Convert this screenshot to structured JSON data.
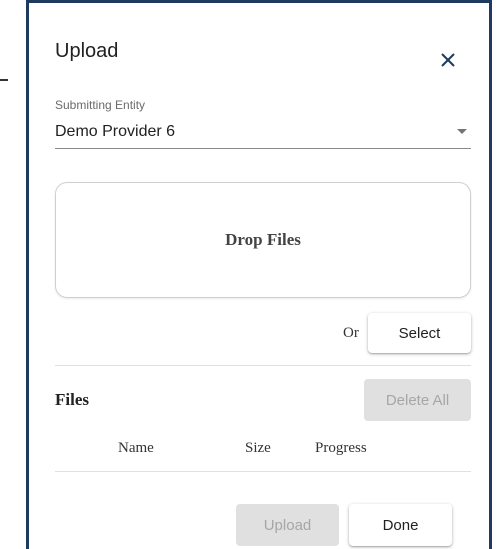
{
  "dialog": {
    "title": "Upload",
    "close_icon": "close-icon"
  },
  "entity_select": {
    "label": "Submitting Entity",
    "value": "Demo Provider 6",
    "arrow_icon": "dropdown-arrow-icon"
  },
  "dropzone": {
    "text": "Drop Files"
  },
  "picker": {
    "or_text": "Or",
    "select_label": "Select"
  },
  "files": {
    "heading": "Files",
    "delete_all_label": "Delete All",
    "columns": [
      "Name",
      "Size",
      "Progress"
    ],
    "rows": []
  },
  "actions": {
    "upload_label": "Upload",
    "done_label": "Done"
  },
  "colors": {
    "dialog_border": "#1f3a5f",
    "disabled_bg": "#e0e0e0",
    "disabled_text": "#a6a6a6"
  }
}
